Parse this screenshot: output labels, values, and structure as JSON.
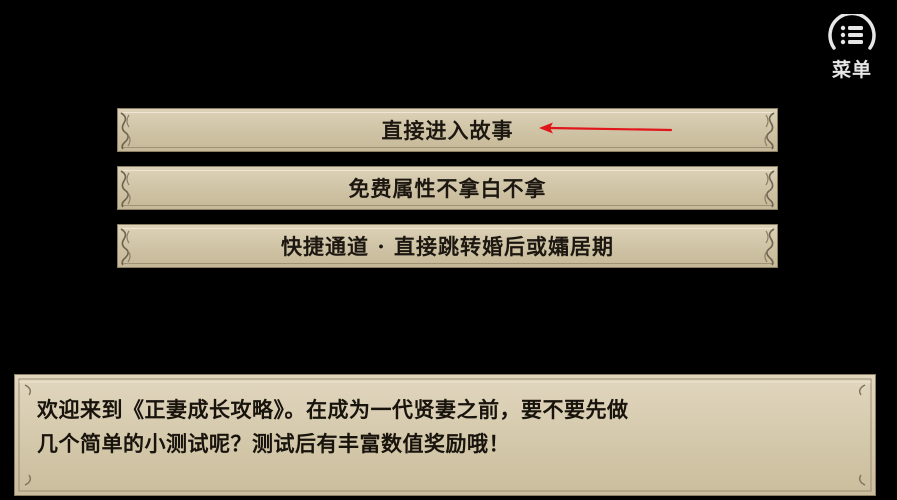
{
  "menu": {
    "label": "菜单",
    "icon": "list-icon"
  },
  "choices": [
    {
      "label": "直接进入故事"
    },
    {
      "label": "免费属性不拿白不拿"
    },
    {
      "label": "快捷通道 · 直接跳转婚后或孀居期"
    }
  ],
  "annotation": {
    "arrow_color": "#e0161b"
  },
  "dialog": {
    "lines": [
      "欢迎来到《正妻成长攻略》。在成为一代贤妻之前，要不要先做",
      "几个简单的小测试呢？测试后有丰富数值奖励哦！"
    ]
  },
  "colors": {
    "background": "#000000",
    "panel": "#d3c7a9",
    "text": "#1c1710"
  }
}
